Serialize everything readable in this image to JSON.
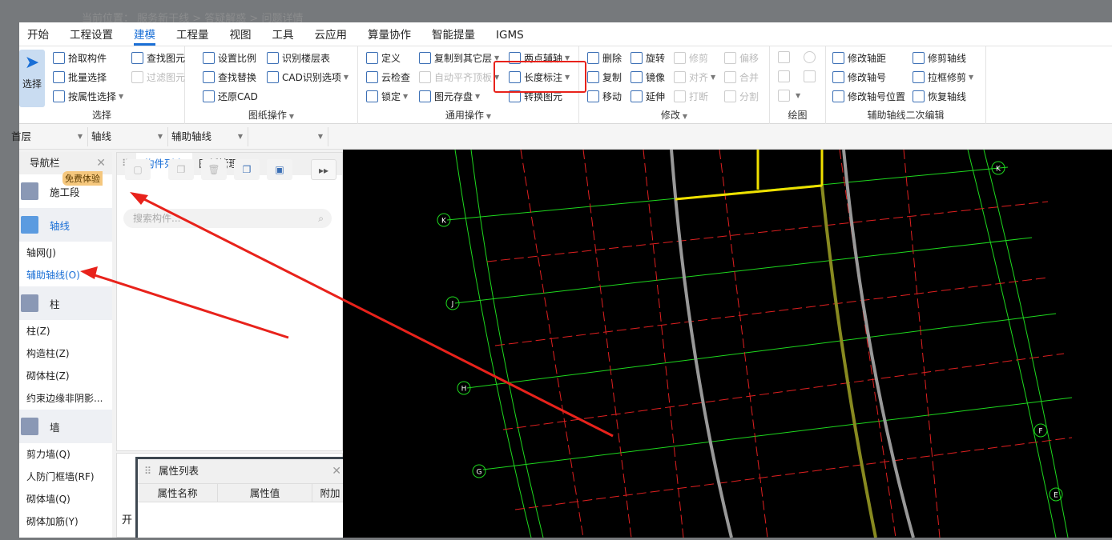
{
  "breadcrumb": "当前位置： 服务新干线 > 答疑解惑 > 问题详情",
  "menu": [
    "开始",
    "工程设置",
    "建模",
    "工程量",
    "视图",
    "工具",
    "云应用",
    "算量协作",
    "智能提量",
    "IGMS"
  ],
  "ribbon": {
    "select": {
      "big": "选择",
      "items": [
        "拾取构件",
        "批量选择",
        "按属性选择",
        "查找图元",
        "过滤图元"
      ],
      "label": "选择"
    },
    "drawing": {
      "items": [
        "设置比例",
        "查找替换",
        "还原CAD",
        "识别楼层表",
        "CAD识别选项"
      ],
      "label": "图纸操作"
    },
    "common": {
      "items": [
        "定义",
        "云检查",
        "锁定",
        "复制到其它层",
        "自动平齐顶板",
        "图元存盘",
        "两点辅轴",
        "长度标注",
        "转换图元"
      ],
      "label": "通用操作"
    },
    "modify": {
      "items": [
        "删除",
        "复制",
        "移动",
        "旋转",
        "镜像",
        "延伸",
        "修剪",
        "对齐",
        "打断",
        "偏移",
        "合并",
        "分割"
      ],
      "label": "修改"
    },
    "draw": {
      "label": "绘图"
    },
    "aux": {
      "items": [
        "修改轴距",
        "修改轴号",
        "修改轴号位置",
        "修剪轴线",
        "拉框修剪",
        "恢复轴线"
      ],
      "label": "辅助轴线二次编辑"
    },
    "highlight_color": "#e8221b"
  },
  "selectors": [
    "首层",
    "轴线",
    "辅助轴线",
    ""
  ],
  "nav": {
    "title": "导航栏",
    "badge": "免费体验",
    "categories": [
      {
        "name": "施工段"
      },
      {
        "name": "轴线",
        "items": [
          "轴网(J)",
          "辅助轴线(O)"
        ]
      },
      {
        "name": "柱",
        "items": [
          "柱(Z)",
          "构造柱(Z)",
          "砌体柱(Z)",
          "约束边缘非阴影..."
        ]
      },
      {
        "name": "墙",
        "items": [
          "剪力墙(Q)",
          "人防门框墙(RF)",
          "砌体墙(Q)",
          "砌体加筋(Y)"
        ]
      }
    ]
  },
  "components": {
    "tabs": [
      "构件列表",
      "图纸管理"
    ],
    "search_placeholder": "搜索构件...",
    "lower_text": "开"
  },
  "properties": {
    "title": "属性列表",
    "columns": [
      "属性名称",
      "属性值",
      "附加"
    ]
  },
  "canvas": {
    "axis_labels_left": [
      "K",
      "J",
      "H",
      "G"
    ],
    "axis_labels_right": [
      "K",
      "F",
      "E"
    ]
  }
}
